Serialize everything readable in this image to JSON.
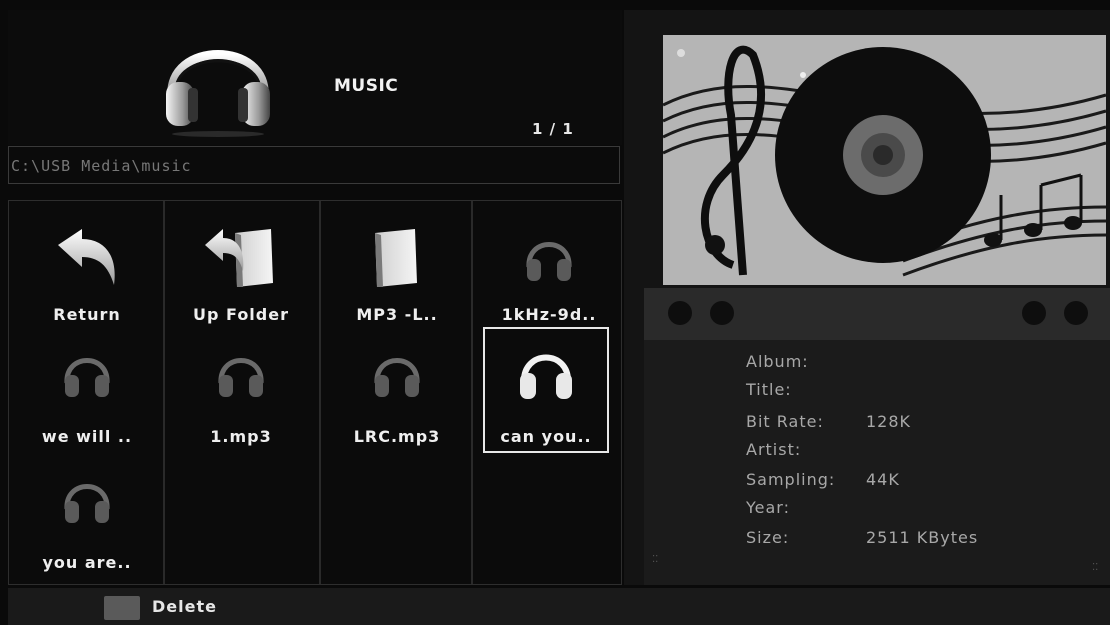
{
  "header": {
    "title": "MUSIC",
    "page_indicator": "1 / 1",
    "icon": "headphones-icon"
  },
  "path": "C:\\USB Media\\music",
  "items": [
    {
      "label": "Return",
      "icon": "return-arrow-icon",
      "selected": false
    },
    {
      "label": "Up Folder",
      "icon": "up-folder-icon",
      "selected": false
    },
    {
      "label": "MP3 -L..",
      "icon": "folder-icon",
      "selected": false
    },
    {
      "label": "1kHz-9d..",
      "icon": "headphones-icon",
      "selected": false
    },
    {
      "label": "we will ..",
      "icon": "headphones-icon",
      "selected": false
    },
    {
      "label": "1.mp3",
      "icon": "headphones-icon",
      "selected": false
    },
    {
      "label": "LRC.mp3",
      "icon": "headphones-icon",
      "selected": false
    },
    {
      "label": "can you..",
      "icon": "headphones-icon",
      "selected": true
    },
    {
      "label": "you are..",
      "icon": "headphones-icon",
      "selected": false
    }
  ],
  "info": {
    "album_label": "Album:",
    "title_label": "Title:",
    "bitrate_label": "Bit Rate:",
    "bitrate_value": "128K",
    "artist_label": "Artist:",
    "sampling_label": "Sampling:",
    "sampling_value": "44K",
    "year_label": "Year:",
    "size_label": "Size:",
    "size_value": "2511 KBytes"
  },
  "footer": {
    "delete_label": "Delete"
  }
}
